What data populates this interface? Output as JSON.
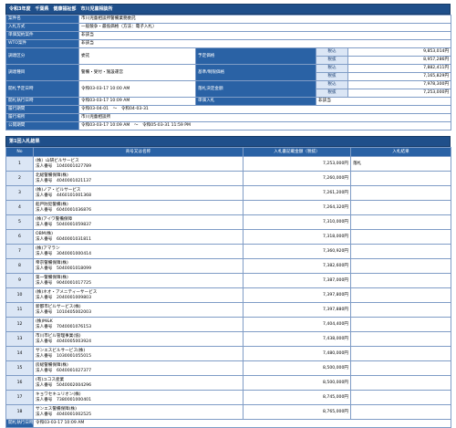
{
  "header": {
    "title": "令和3年度　千葉県　健康福祉部　市川児童相談所"
  },
  "info": {
    "case_name_label": "案件名",
    "case_name": "市川児童相談所警備業務委託",
    "method_label": "入札方式",
    "method": "一般競争・最低価格（方法：電子入札）",
    "sec_label": "単価契約案件",
    "sec_value": "非該当",
    "wto_label": "WTO案件",
    "wto_value": "非該当",
    "kind_label": "調達区分",
    "kind": "委託",
    "category_label": "調達種目",
    "category": "警備・受付・施設運営",
    "planned_label": "予定価格",
    "planned_taxin": "9,853,014円",
    "planned_taxout": "8,957,286円",
    "base_label": "基準/制限価格",
    "base_taxin": "7,882,411円",
    "base_taxout": "7,165,829円",
    "award_label": "落札決定金額",
    "award_taxin": "7,978,300円",
    "award_taxout": "7,253,000円",
    "taxin": "税込",
    "taxout": "税抜",
    "open_plan_label": "開札予定日時",
    "open_plan": "令和03-03-17 10:00 AM",
    "open_label": "開札執行日時",
    "open": "令和03-03-17 10:09 AM",
    "unit_label": "単価入札",
    "unit_value": "非該当",
    "period_label": "履行期間",
    "period": "令和03-04-01　～　令和04-03-31",
    "place_label": "履行場所",
    "place": "市川児童相談所",
    "pub_label": "公開期間",
    "pub": "令和03-03-17 10:09 AM　～　令和05-03-31 11:59 PM"
  },
  "results": {
    "title": "第1回入札結果",
    "col_no": "No",
    "col_name": "商号又は名称",
    "col_amount": "入札書記載金額（税抜）",
    "col_result": "入札結果",
    "corp_label": "法人番号",
    "bidders": [
      {
        "no": "1",
        "name": "(株）山研ビルサービス",
        "corp": "1040001027789",
        "amount": "7,253,000円",
        "result": "落札"
      },
      {
        "no": "2",
        "name": "北総警備保障(株)",
        "corp": "4040001021137",
        "amount": "7,260,000円",
        "result": ""
      },
      {
        "no": "3",
        "name": "(株)ノア・ビルサービス",
        "corp": "4460101001368",
        "amount": "7,261,200円",
        "result": ""
      },
      {
        "no": "4",
        "name": "船戸防犯警備(株)",
        "corp": "6040001036876",
        "amount": "7,264,320円",
        "result": ""
      },
      {
        "no": "5",
        "name": "(株)アイワ警備保障",
        "corp": "5040001059837",
        "amount": "7,310,000円",
        "result": ""
      },
      {
        "no": "6",
        "name": "OBM(株)",
        "corp": "6040001031811",
        "amount": "7,318,000円",
        "result": ""
      },
      {
        "no": "7",
        "name": "(株)アマラン",
        "corp": "3040001000414",
        "amount": "7,360,920円",
        "result": ""
      },
      {
        "no": "8",
        "name": "帝京警備保障(株)",
        "corp": "5040001018099",
        "amount": "7,382,600円",
        "result": ""
      },
      {
        "no": "9",
        "name": "第一警備保障(株)",
        "corp": "9040001017725",
        "amount": "7,387,000円",
        "result": ""
      },
      {
        "no": "10",
        "name": "(株)ネオ・アメニティーサービス",
        "corp": "2040001009803",
        "amount": "7,397,800円",
        "result": ""
      },
      {
        "no": "11",
        "name": "新都市ビルサービス(株)",
        "corp": "1010405002003",
        "amount": "7,397,880円",
        "result": ""
      },
      {
        "no": "12",
        "name": "(株)M&K",
        "corp": "7040001076153",
        "amount": "7,404,400円",
        "result": ""
      },
      {
        "no": "13",
        "name": "市川市ビル管理事業(協)",
        "corp": "4040005003924",
        "amount": "7,438,000円",
        "result": ""
      },
      {
        "no": "14",
        "name": "サンエスビルサービス(株)",
        "corp": "1030001055015",
        "amount": "7,480,000円",
        "result": ""
      },
      {
        "no": "15",
        "name": "房総警備保障(株)",
        "corp": "6040001027377",
        "amount": "8,500,000円",
        "result": ""
      },
      {
        "no": "16",
        "name": "(有)ユコス産業",
        "corp": "5040002004296",
        "amount": "8,500,000円",
        "result": ""
      },
      {
        "no": "17",
        "name": "キョワセキュリオン(株)",
        "corp": "7380001000401",
        "amount": "8,745,000円",
        "result": ""
      },
      {
        "no": "18",
        "name": "サンエス警備保障(株)",
        "corp": "4040001002525",
        "amount": "8,765,000円",
        "result": ""
      }
    ],
    "footer_label": "開札執行日時",
    "footer_value": "令和03-03-17 10:09 AM"
  }
}
